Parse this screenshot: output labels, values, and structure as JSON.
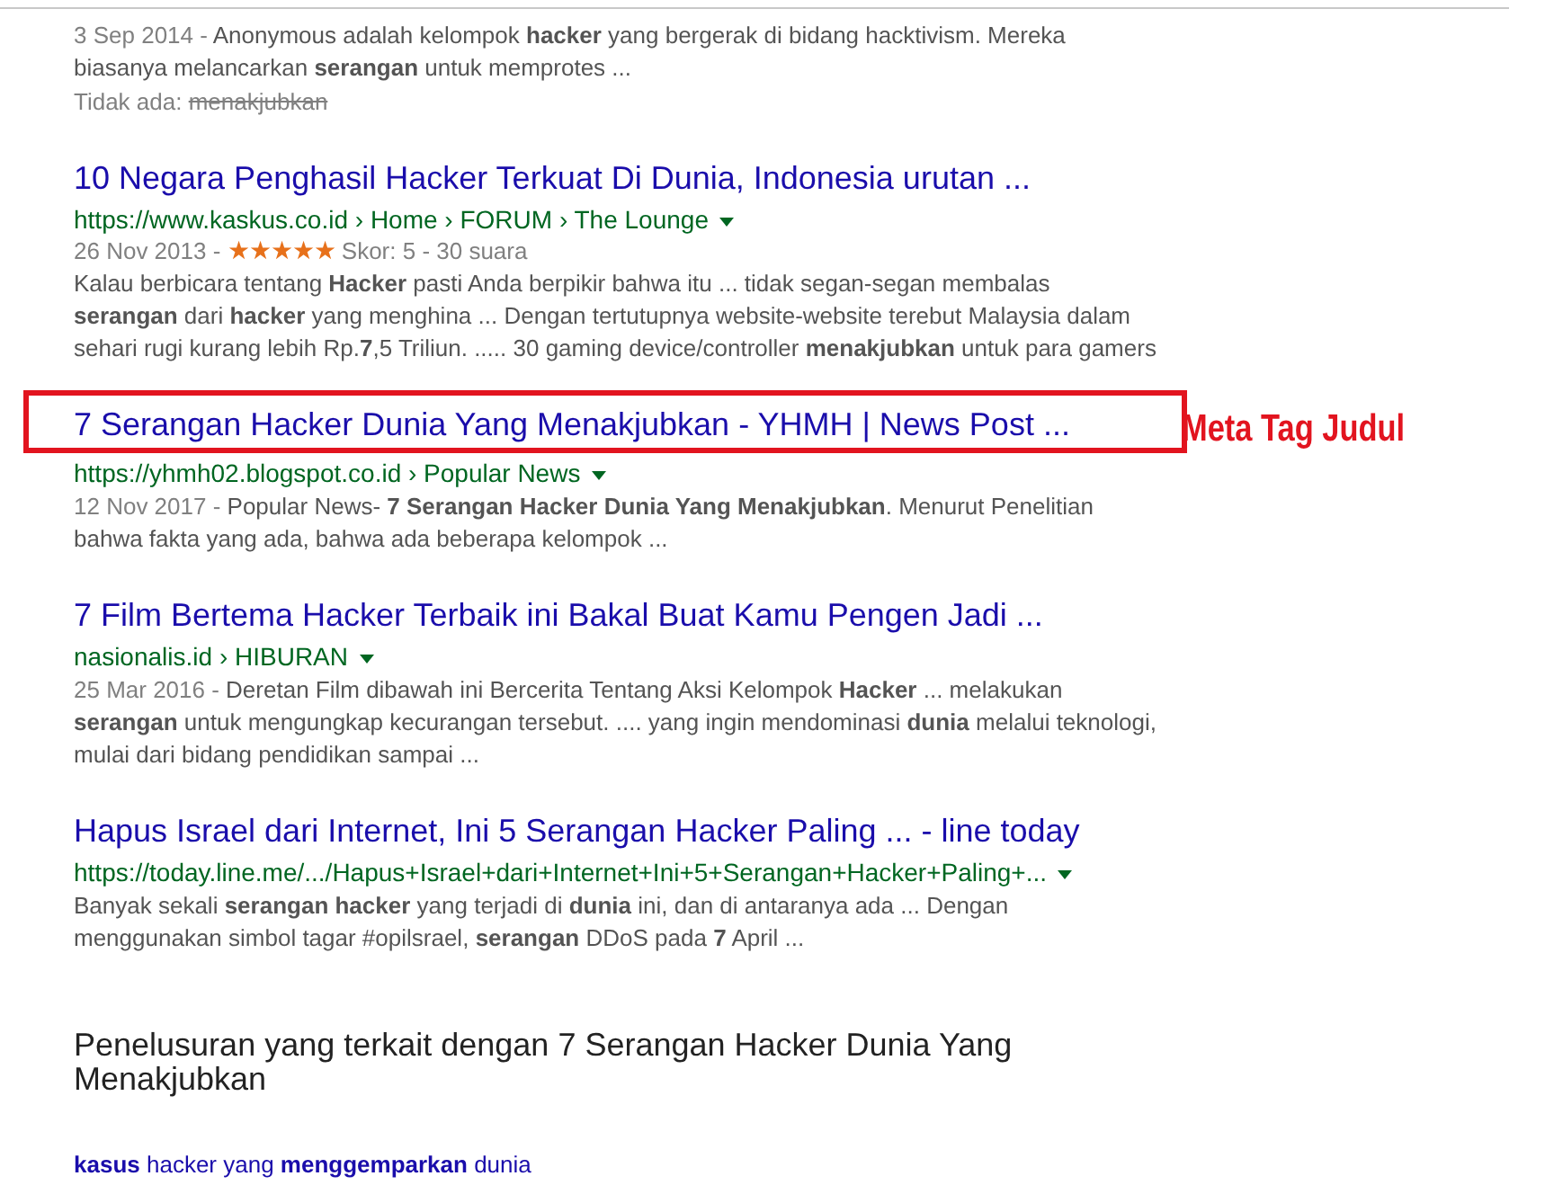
{
  "results": [
    {
      "date": "3 Sep 2014 -",
      "snippet": "Anonymous adalah kelompok **hacker** yang bergerak di bidang hacktivism. Mereka biasanya melancarkan **serangan** untuk memprotes ...",
      "missing_label": "Tidak ada:",
      "missing_term": "menakjubkan"
    },
    {
      "title": "10 Negara Penghasil Hacker Terkuat Di Dunia, Indonesia urutan ...",
      "url": "https://www.kaskus.co.id › Home › FORUM › The Lounge",
      "date": "26 Nov 2013 -",
      "stars": 5,
      "rating_text": "Skor: 5 - 30 suara",
      "snippet": "Kalau berbicara tentang **Hacker** pasti Anda berpikir bahwa itu ... tidak segan-segan membalas **serangan** dari **hacker** yang menghina ... Dengan tertutupnya website-website terebut Malaysia dalam sehari rugi kurang lebih Rp.**7**,5 Triliun. ..... 30 gaming device/controller **menakjubkan** untuk para gamers"
    },
    {
      "title": "7 Serangan Hacker Dunia Yang Menakjubkan - YHMH | News Post ...",
      "url": "https://yhmh02.blogspot.co.id › Popular News",
      "date": "12 Nov 2017 -",
      "snippet": "Popular News- **7 Serangan Hacker Dunia Yang Menakjubkan**. Menurut Penelitian bahwa fakta yang ada, bahwa ada beberapa kelompok ...",
      "highlighted": true,
      "annotation": "Meta Tag Judul"
    },
    {
      "title": "7 Film Bertema Hacker Terbaik ini Bakal Buat Kamu Pengen Jadi ...",
      "url": "nasionalis.id › HIBURAN",
      "date": "25 Mar 2016 -",
      "snippet": "Deretan Film dibawah ini Bercerita Tentang Aksi Kelompok **Hacker** ... melakukan **serangan** untuk mengungkap kecurangan tersebut. .... yang ingin mendominasi **dunia** melalui teknologi, mulai dari bidang pendidikan sampai ..."
    },
    {
      "title": "Hapus Israel dari Internet, Ini 5 Serangan Hacker Paling ... - line today",
      "url": "https://today.line.me/.../Hapus+Israel+dari+Internet+Ini+5+Serangan+Hacker+Paling+...",
      "snippet": "Banyak sekali **serangan hacker** yang terjadi di **dunia** ini, dan di antaranya ada ... Dengan menggunakan simbol tagar #opilsrael, **serangan** DDoS pada **7** April ..."
    }
  ],
  "related": {
    "heading": "Penelusuran yang terkait dengan 7 Serangan Hacker Dunia Yang Menakjubkan",
    "items": [
      "**kasus** hacker yang **menggemparkan** dunia"
    ]
  }
}
